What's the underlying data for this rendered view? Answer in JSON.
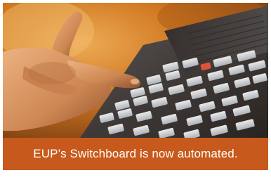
{
  "caption": {
    "text": "EUP’s Switchboard is now automated."
  },
  "colors": {
    "caption_bar": "#c8591c",
    "caption_text": "#ffffff",
    "background_warm": "#d9822b",
    "device_body": "#3a3c40",
    "key_face": "#d8e2ec",
    "skin": "#d99866"
  },
  "photo": {
    "subject": "hand pressing keys on a switchboard console"
  }
}
